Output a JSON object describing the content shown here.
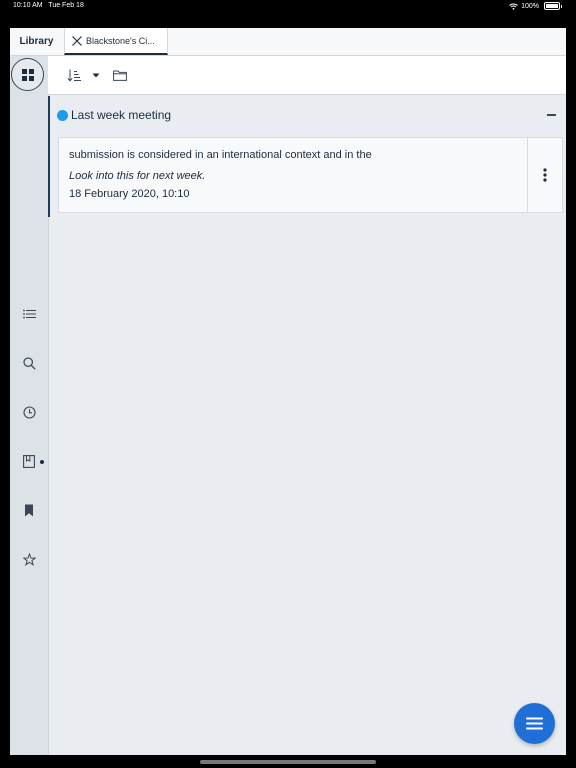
{
  "status": {
    "time": "10:10 AM",
    "date": "Tue Feb 18",
    "battery": "100%"
  },
  "tabs": {
    "library": "Library",
    "document": "Blackstone's Ci..."
  },
  "sidebar": {
    "items": [
      {
        "name": "table-of-contents-icon"
      },
      {
        "name": "search-icon"
      },
      {
        "name": "history-icon"
      },
      {
        "name": "notebook-icon"
      },
      {
        "name": "bookmark-icon"
      },
      {
        "name": "favourites-star-icon"
      }
    ]
  },
  "group": {
    "title": "Last week meeting",
    "color": "#1e9be8",
    "card": {
      "text": "submission is considered in an international context and in the",
      "note": "Look into this for next week.",
      "date": "18 February 2020, 10:10"
    }
  },
  "colors": {
    "accent": "#1f6fd6",
    "text": "#1c2d3e"
  }
}
